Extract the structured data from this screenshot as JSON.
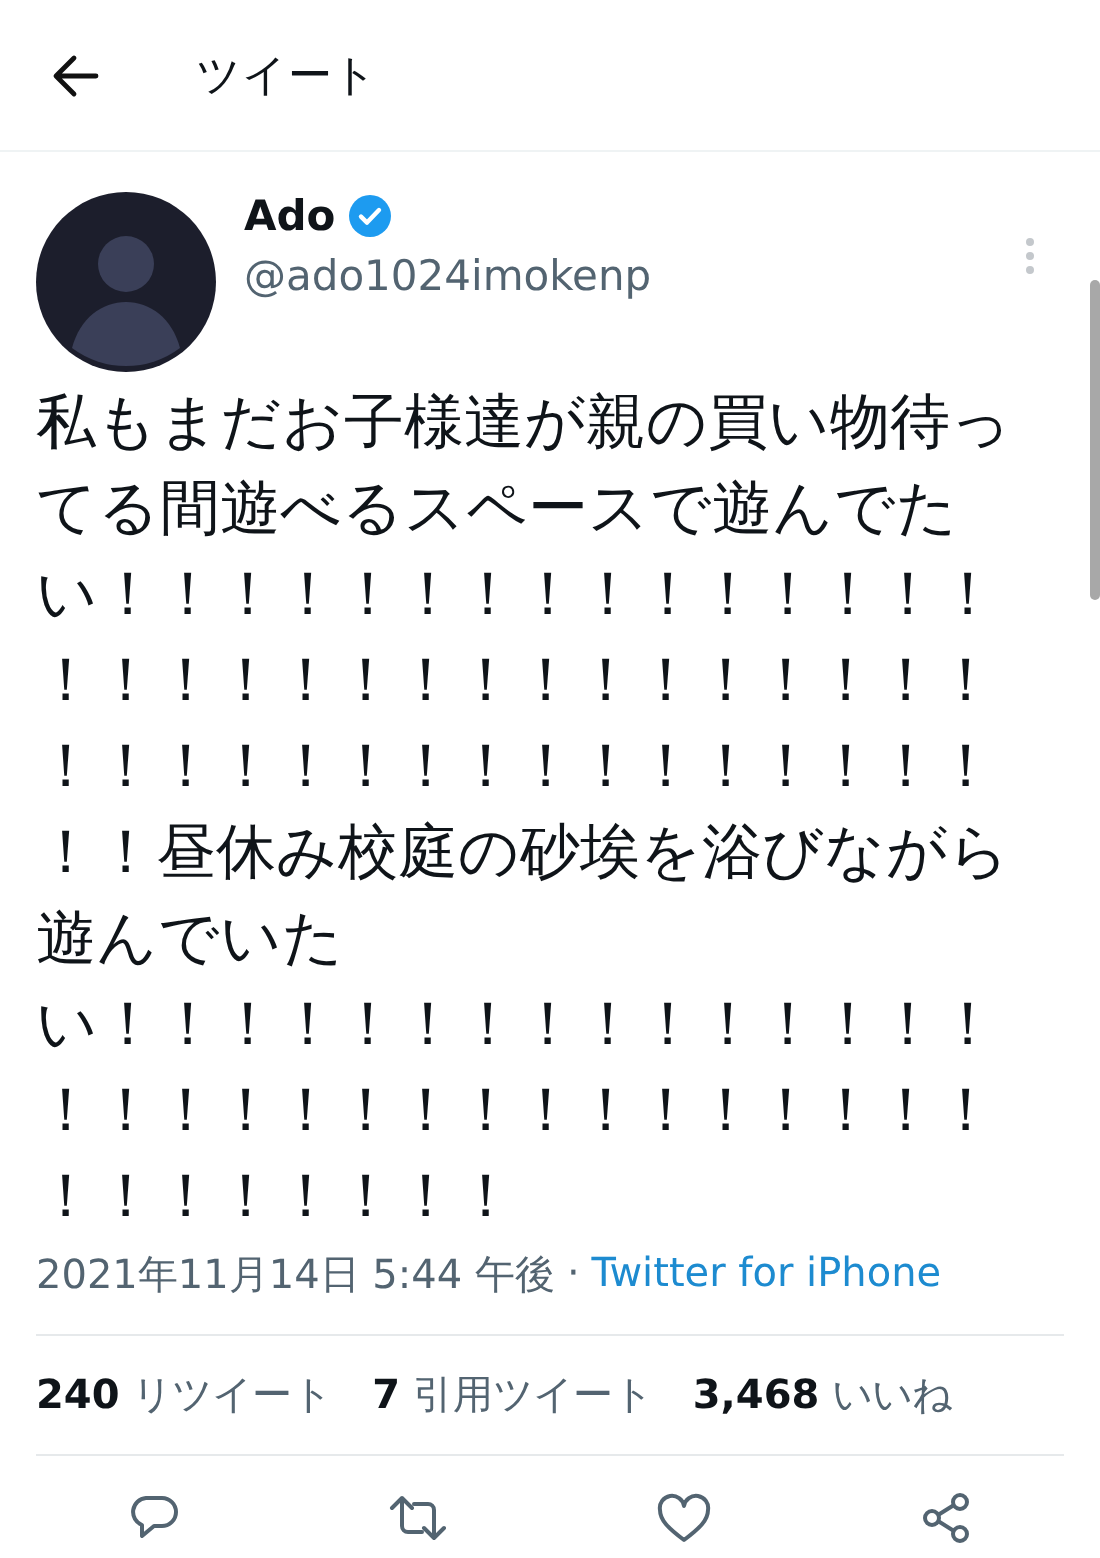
{
  "header": {
    "title": "ツイート"
  },
  "tweet": {
    "author": {
      "name": "Ado",
      "verified": true,
      "handle": "@ado1024imokenp"
    },
    "text_lines": [
      "私もまだお子様達が親の買い物待っ",
      "てる間遊べるスペースで遊んでた",
      "い！！！！！！！！！！！！！！！",
      "！！！！！！！！！！！！！！！！",
      "！！！！！！！！！！！！！！！！",
      "！！昼休み校庭の砂埃を浴びながら",
      "遊んでいた",
      "い！！！！！！！！！！！！！！！",
      "！！！！！！！！！！！！！！！！",
      "！！！！！！！！"
    ],
    "timestamp": "2021年11月14日 5:44 午後",
    "separator": "·",
    "source": "Twitter for iPhone"
  },
  "stats": [
    {
      "count": "240",
      "label": "リツイート"
    },
    {
      "count": "7",
      "label": "引用ツイート"
    },
    {
      "count": "3,468",
      "label": "いいね"
    }
  ],
  "actions": [
    {
      "kind": "reply"
    },
    {
      "kind": "retweet"
    },
    {
      "kind": "like"
    },
    {
      "kind": "share"
    }
  ]
}
